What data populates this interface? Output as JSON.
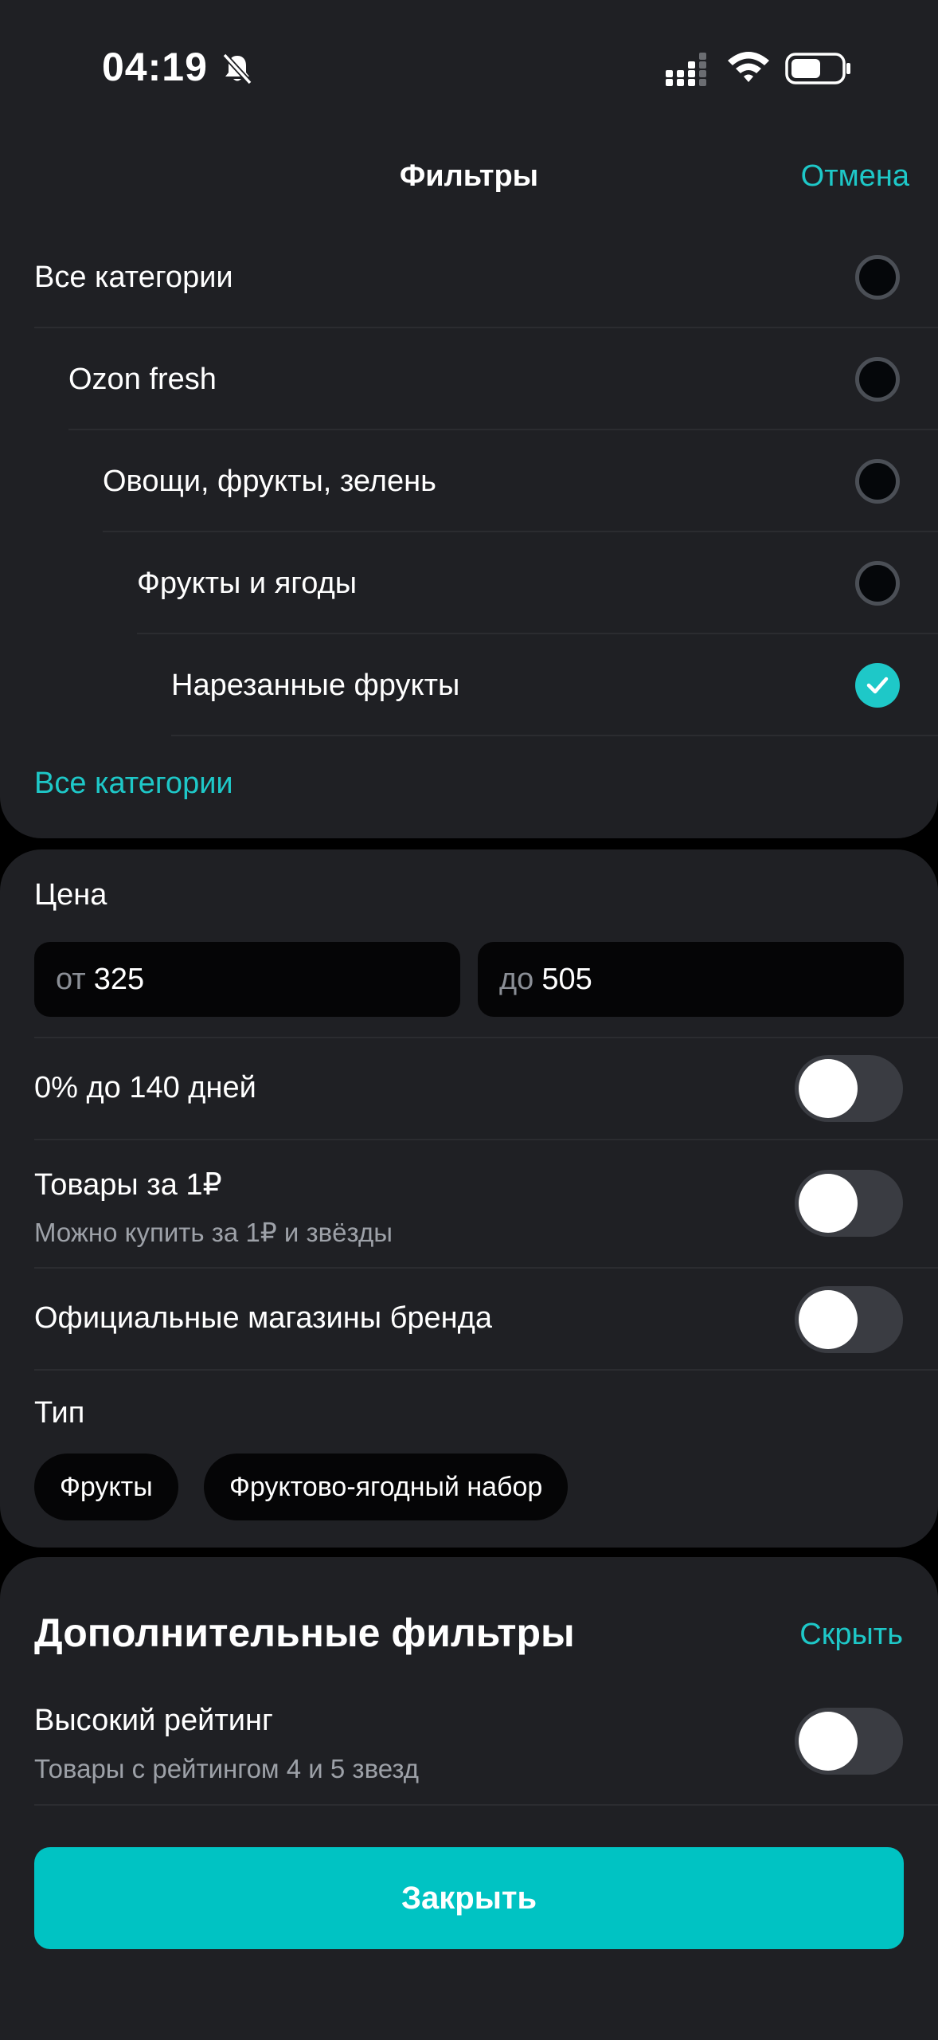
{
  "status_bar": {
    "time": "04:19"
  },
  "header": {
    "title": "Фильтры",
    "cancel": "Отмена"
  },
  "categories": {
    "items": [
      {
        "label": "Все категории",
        "checked": false
      },
      {
        "label": "Ozon fresh",
        "checked": false
      },
      {
        "label": "Овощи, фрукты, зелень",
        "checked": false
      },
      {
        "label": "Фрукты и ягоды",
        "checked": false
      },
      {
        "label": "Нарезанные фрукты",
        "checked": true
      }
    ],
    "all_link": "Все категории"
  },
  "price": {
    "title": "Цена",
    "from_prefix": "от",
    "from_value": "325",
    "to_prefix": "до",
    "to_value": "505"
  },
  "toggles": [
    {
      "label": "0% до 140 дней",
      "on": false
    },
    {
      "label": "Товары за 1₽",
      "sub": "Можно купить за 1₽ и звёзды",
      "on": false
    },
    {
      "label": "Официальные магазины бренда",
      "on": false
    }
  ],
  "type": {
    "title": "Тип",
    "chips": [
      "Фрукты",
      "Фруктово-ягодный набор"
    ]
  },
  "extra": {
    "title": "Дополнительные фильтры",
    "hide": "Скрыть",
    "high_rating": {
      "label": "Высокий рейтинг",
      "sub": "Товары с рейтингом 4 и 5 звезд",
      "on": false
    }
  },
  "close_button": "Закрыть",
  "colors": {
    "accent": "#1ec8c8",
    "button": "#00c3c3",
    "surface": "#1f2024",
    "background": "#000000"
  }
}
